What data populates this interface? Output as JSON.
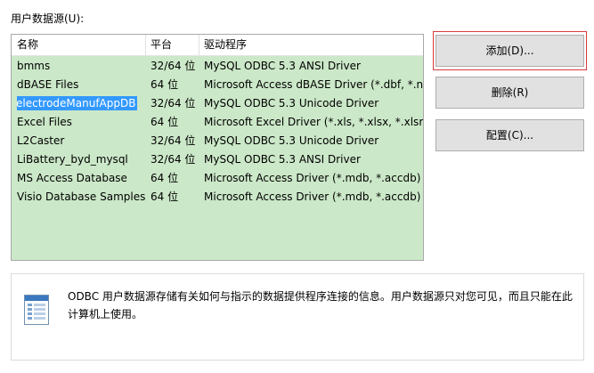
{
  "section_label": "用户数据源(U):",
  "table": {
    "columns": [
      "名称",
      "平台",
      "驱动程序"
    ],
    "rows": [
      {
        "name": "bmms",
        "platform": "32/64 位",
        "driver": "MySQL ODBC 5.3 ANSI Driver"
      },
      {
        "name": "dBASE Files",
        "platform": "64 位",
        "driver": "Microsoft Access dBASE Driver (*.dbf, *.ndx"
      },
      {
        "name": "electrodeManufAppDB",
        "platform": "32/64 位",
        "driver": "MySQL ODBC 5.3 Unicode Driver",
        "selected": true
      },
      {
        "name": "Excel Files",
        "platform": "64 位",
        "driver": "Microsoft Excel Driver (*.xls, *.xlsx, *.xlsm, *"
      },
      {
        "name": "L2Caster",
        "platform": "32/64 位",
        "driver": "MySQL ODBC 5.3 Unicode Driver"
      },
      {
        "name": "LiBattery_byd_mysql",
        "platform": "32/64 位",
        "driver": "MySQL ODBC 5.3 ANSI Driver"
      },
      {
        "name": "MS Access Database",
        "platform": "64 位",
        "driver": "Microsoft Access Driver (*.mdb, *.accdb)"
      },
      {
        "name": "Visio Database Samples",
        "platform": "64 位",
        "driver": "Microsoft Access Driver (*.mdb, *.accdb)"
      }
    ]
  },
  "buttons": {
    "add": "添加(D)...",
    "remove": "删除(R)",
    "configure": "配置(C)..."
  },
  "info": {
    "icon": "data-source-icon",
    "text": "ODBC 用户数据源存储有关如何与指示的数据提供程序连接的信息。用户数据源只对您可见，而且只能在此计算机上使用。"
  },
  "colors": {
    "list_background": "#cbe8c8",
    "selection": "#3399ff",
    "focus_border": "#d83b3b"
  }
}
